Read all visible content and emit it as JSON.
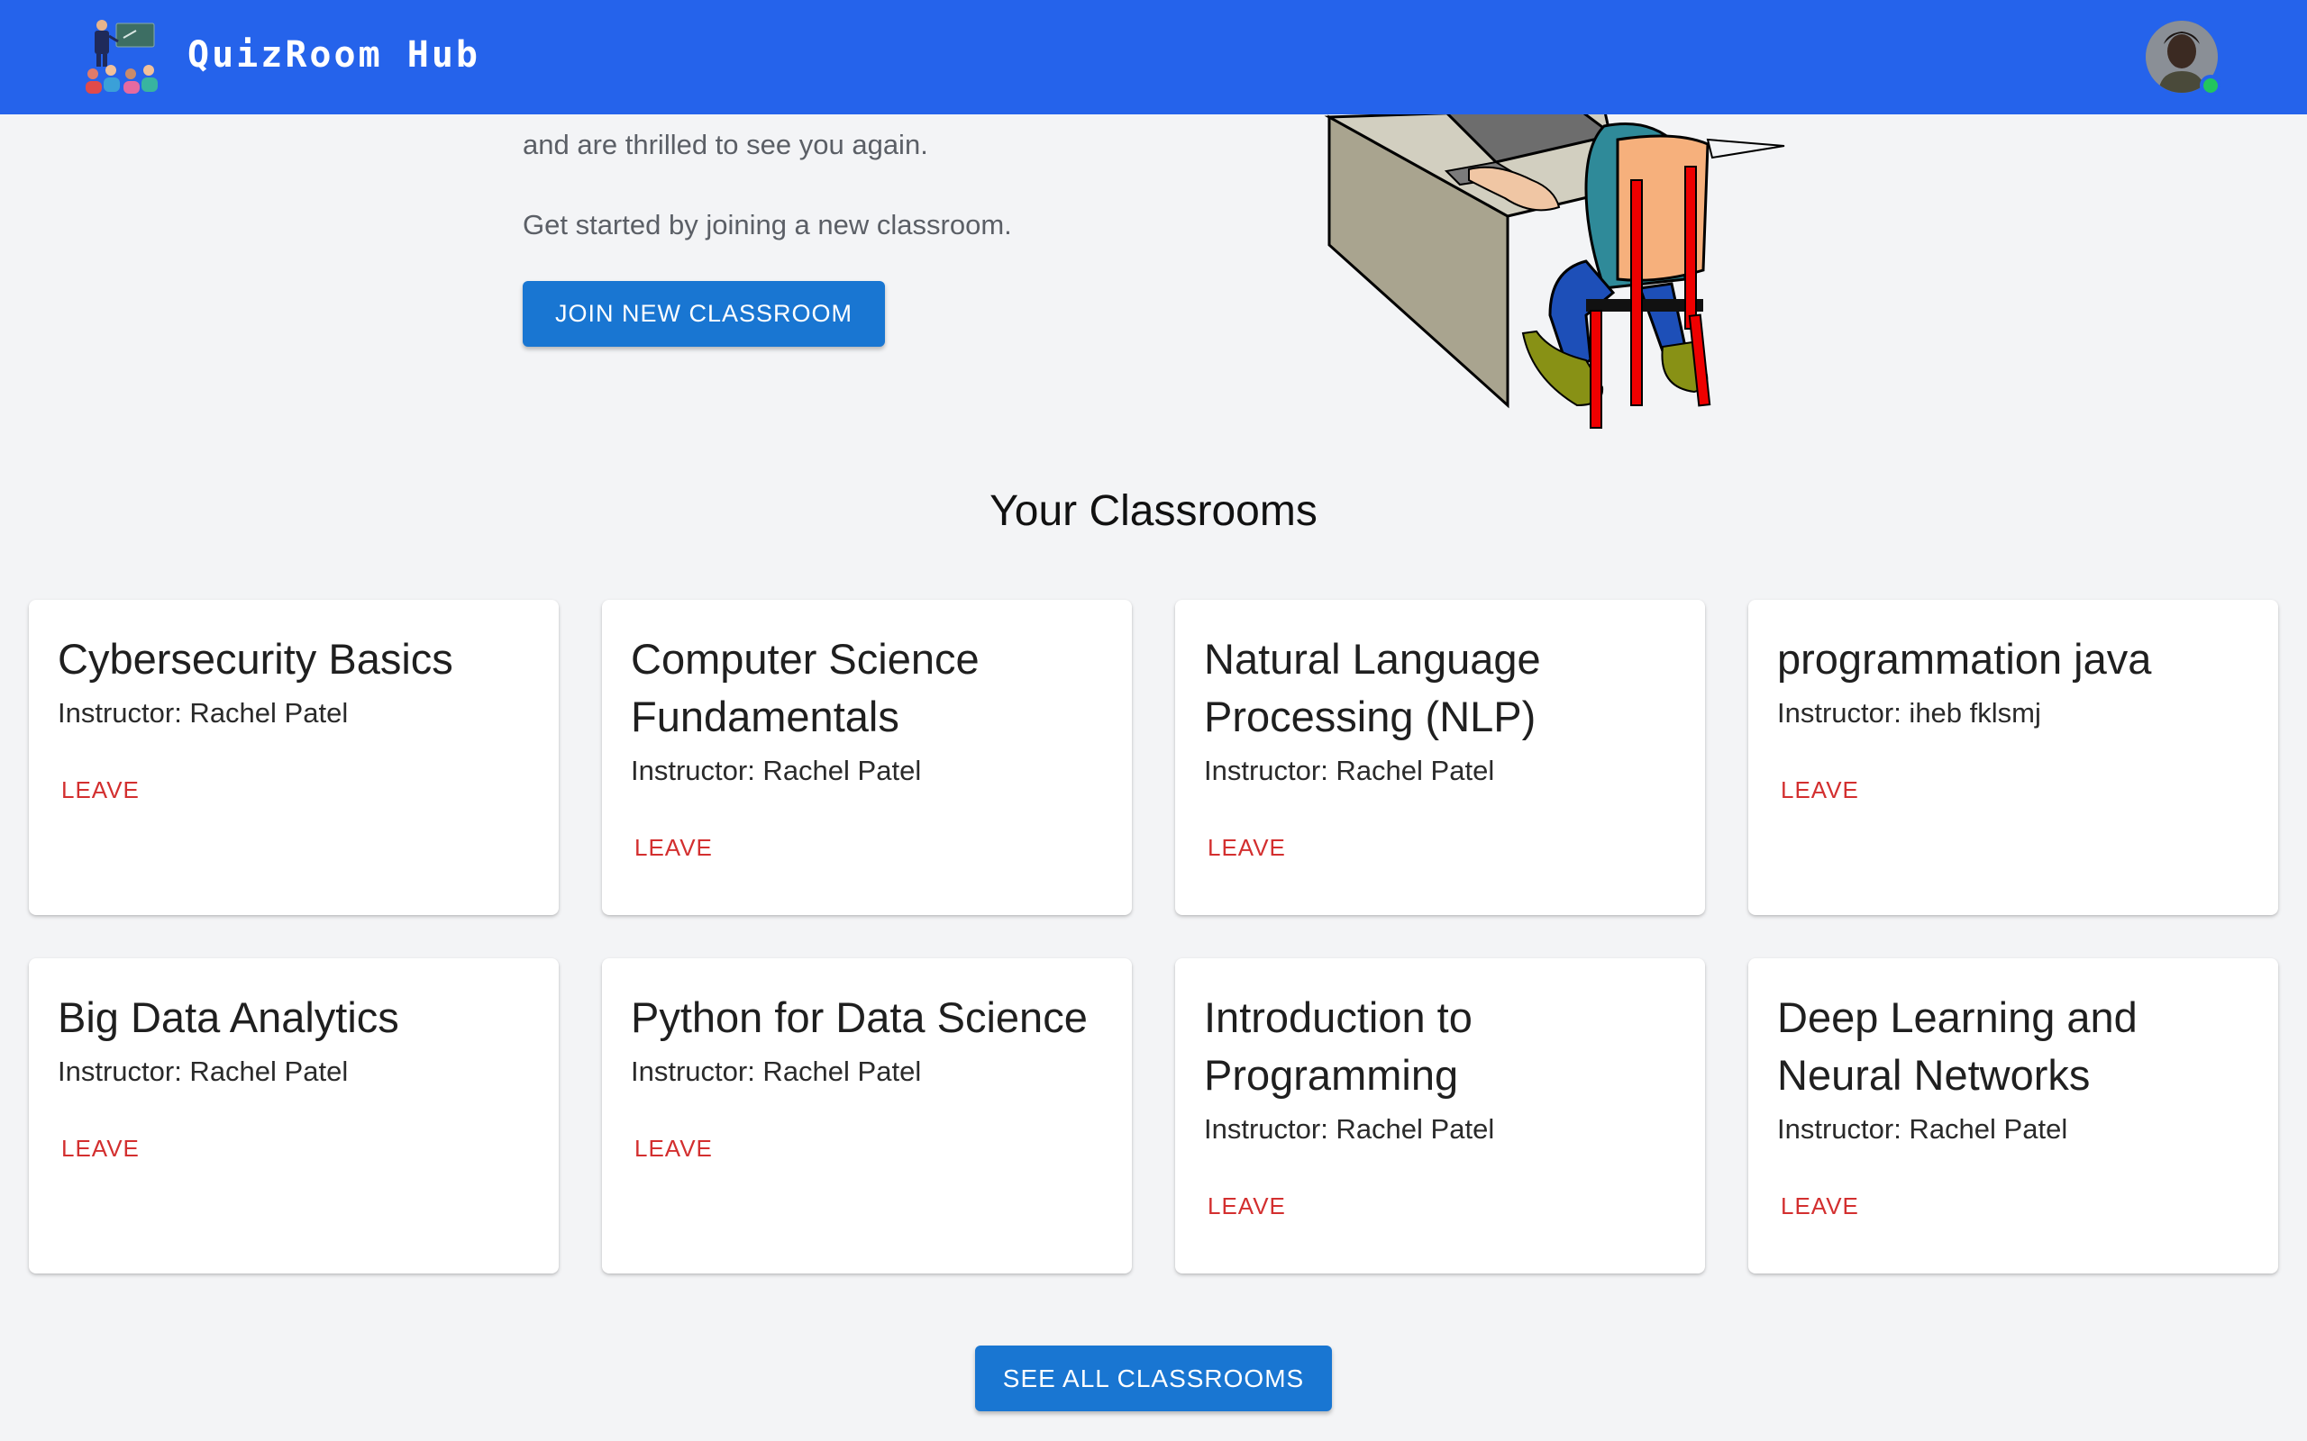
{
  "header": {
    "brand": "QuizRoom Hub",
    "logo_icon": "classroom-teacher-logo-icon",
    "avatar_icon": "user-avatar-icon",
    "status": "online",
    "colors": {
      "bar": "#2563eb",
      "online": "#22c55e"
    }
  },
  "hero": {
    "line1": "and are thrilled to see you again.",
    "line2": "Get started by joining a new classroom.",
    "join_button": "JOIN NEW CLASSROOM",
    "illustration_icon": "student-at-desk-illustration"
  },
  "classrooms": {
    "title": "Your Classrooms",
    "items": [
      {
        "name": "Cybersecurity Basics",
        "instructor": "Instructor: Rachel Patel",
        "action": "LEAVE"
      },
      {
        "name": "Computer Science Fundamentals",
        "instructor": "Instructor: Rachel Patel",
        "action": "LEAVE"
      },
      {
        "name": "Natural Language Processing (NLP)",
        "instructor": "Instructor: Rachel Patel",
        "action": "LEAVE"
      },
      {
        "name": "programmation java",
        "instructor": "Instructor: iheb fklsmj",
        "action": "LEAVE"
      },
      {
        "name": "Big Data Analytics",
        "instructor": "Instructor: Rachel Patel",
        "action": "LEAVE"
      },
      {
        "name": "Python for Data Science",
        "instructor": "Instructor: Rachel Patel",
        "action": "LEAVE"
      },
      {
        "name": "Introduction to Programming",
        "instructor": "Instructor: Rachel Patel",
        "action": "LEAVE"
      },
      {
        "name": "Deep Learning and Neural Networks",
        "instructor": "Instructor: Rachel Patel",
        "action": "LEAVE"
      }
    ],
    "see_all_button": "SEE ALL CLASSROOMS",
    "colors": {
      "primary_button": "#1976d2",
      "leave": "#d32f2f"
    }
  }
}
